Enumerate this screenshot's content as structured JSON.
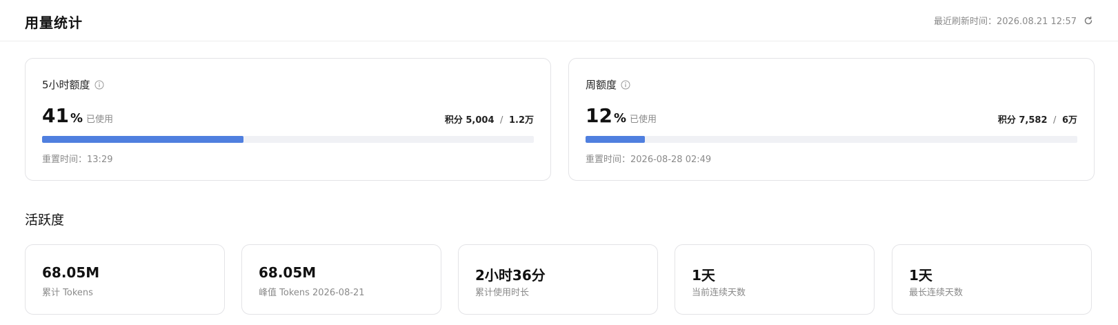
{
  "header": {
    "title": "用量统计",
    "refresh_label": "最近刷新时间：",
    "refresh_time": "2026.08.21 12:57",
    "refresh_icon": "refresh-icon"
  },
  "quotas": [
    {
      "title": "5小时额度",
      "percent": 41,
      "percent_text": "41",
      "percent_sign": "%",
      "used_label": "已使用",
      "credits_label": "积分",
      "credits_used": "5,004",
      "credits_sep": "/",
      "credits_total": "1.2万",
      "reset_label": "重置时间：",
      "reset_time": "13:29"
    },
    {
      "title": "周额度",
      "percent": 12,
      "percent_text": "12",
      "percent_sign": "%",
      "used_label": "已使用",
      "credits_label": "积分",
      "credits_used": "7,582",
      "credits_sep": "/",
      "credits_total": "6万",
      "reset_label": "重置时间：",
      "reset_time": "2026-08-28 02:49"
    }
  ],
  "activity": {
    "title": "活跃度",
    "stats": [
      {
        "value": "68.05M",
        "label": "累计 Tokens"
      },
      {
        "value": "68.05M",
        "label": "峰值 Tokens 2026-08-21"
      },
      {
        "value": "2小时36分",
        "label": "累计使用时长"
      },
      {
        "value": "1天",
        "label": "当前连续天数"
      },
      {
        "value": "1天",
        "label": "最长连续天数"
      }
    ]
  },
  "colors": {
    "accent": "#4f7fdf",
    "track": "#f0f1f5",
    "border": "#e3e3e6",
    "muted_text": "#8a8a8a"
  }
}
